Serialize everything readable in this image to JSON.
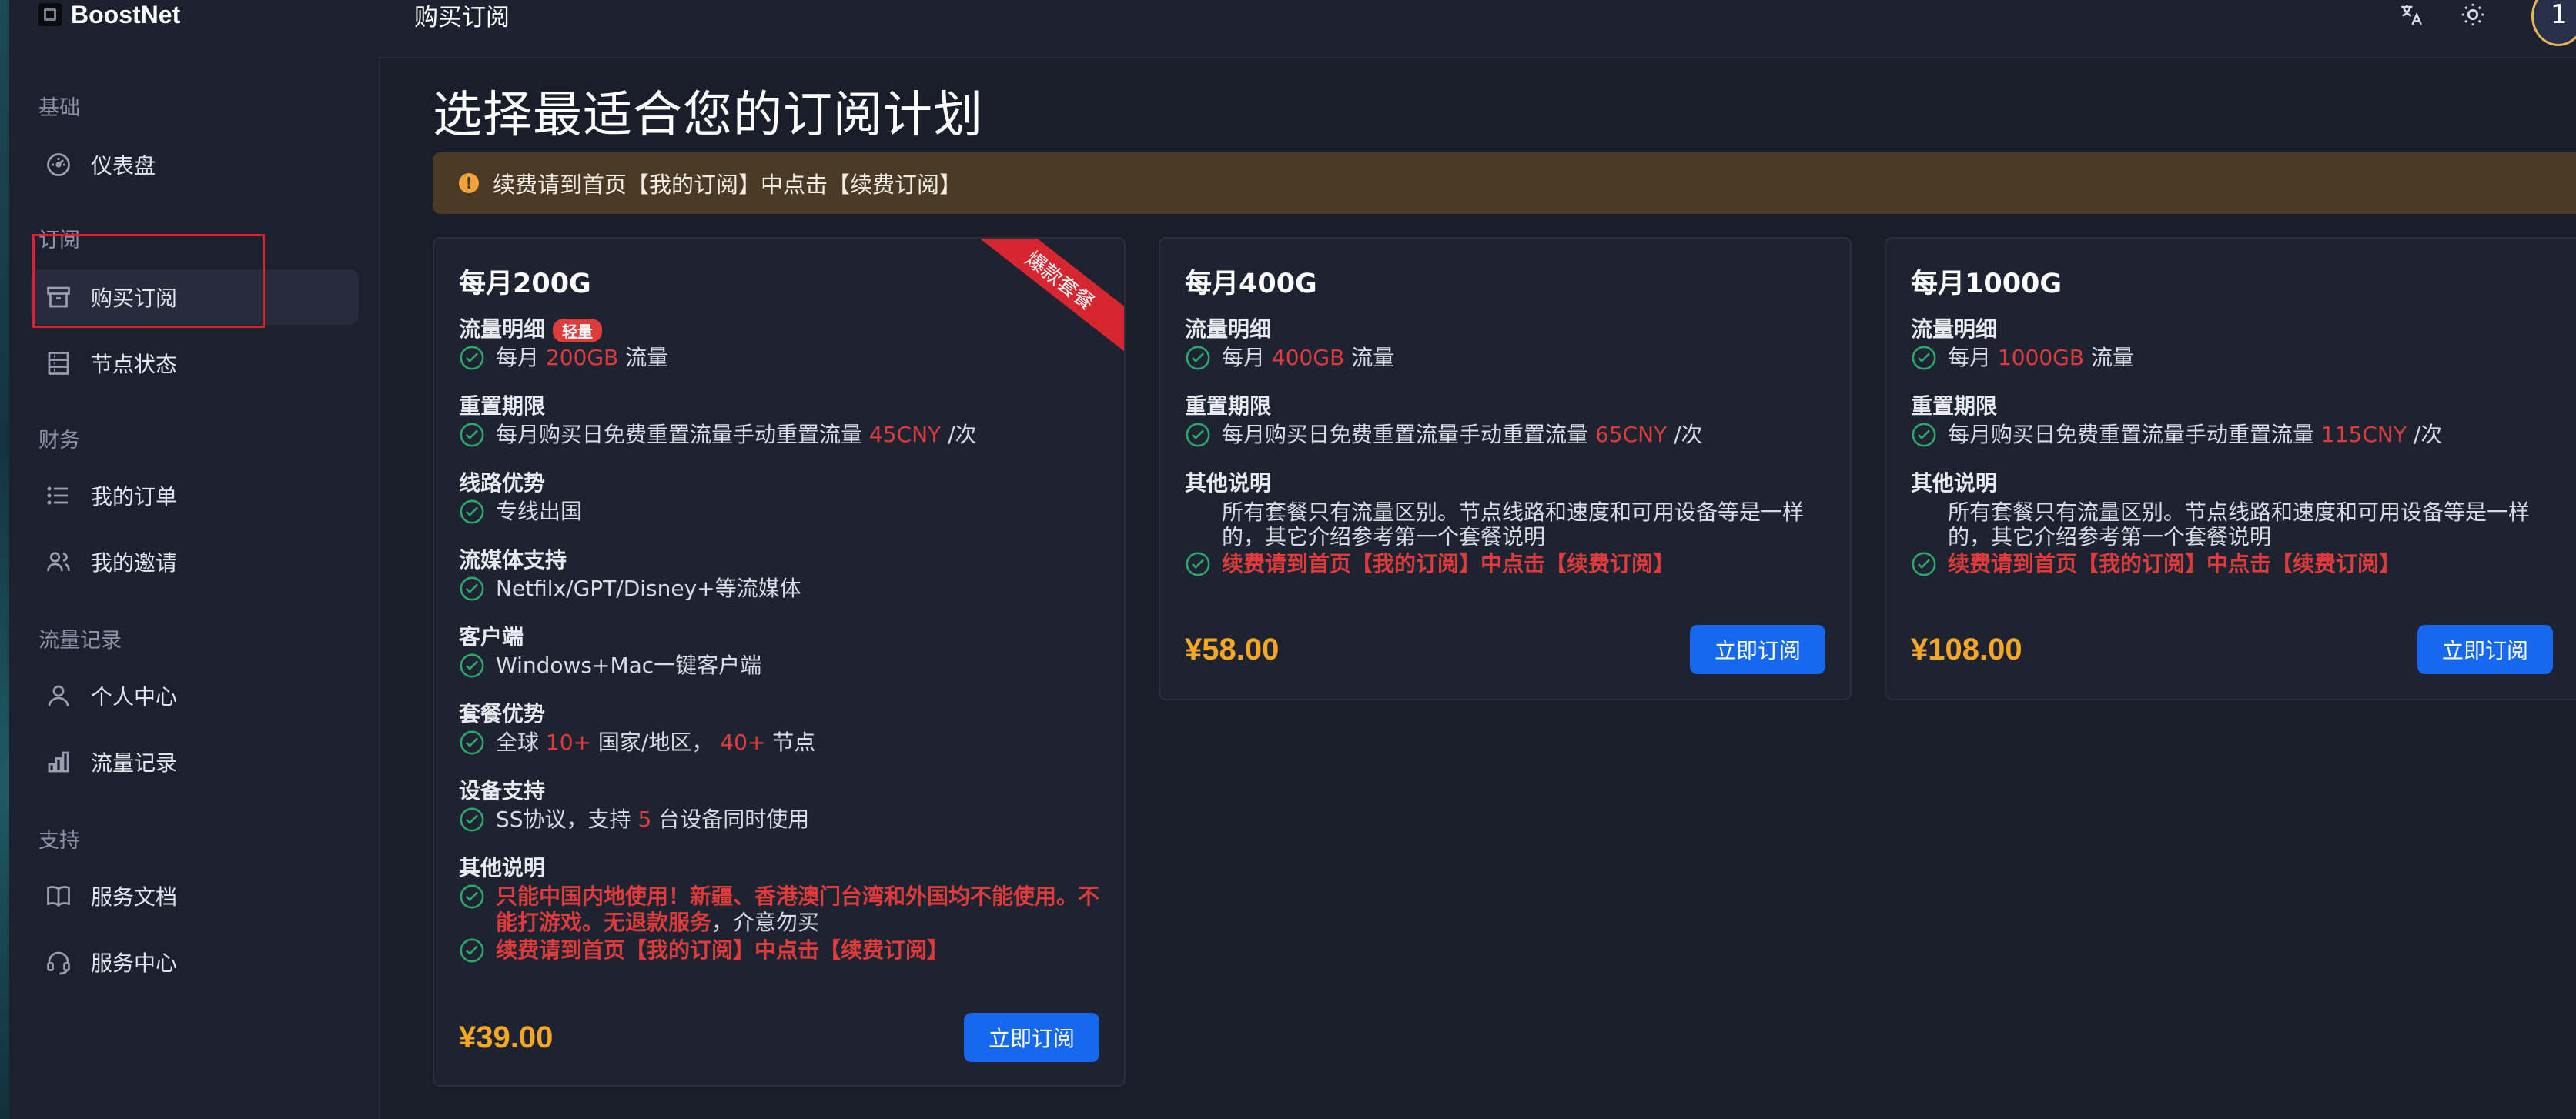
{
  "app": {
    "name": "BoostNet",
    "page_heading": "购买订阅",
    "avatar_text": "1"
  },
  "sidebar": {
    "groups": [
      {
        "label": "基础",
        "items": [
          {
            "label": "仪表盘",
            "icon": "dashboard-icon"
          }
        ]
      },
      {
        "label": "订阅",
        "items": [
          {
            "label": "购买订阅",
            "icon": "box-icon",
            "active": true
          },
          {
            "label": "节点状态",
            "icon": "server-icon"
          }
        ]
      },
      {
        "label": "财务",
        "items": [
          {
            "label": "我的订单",
            "icon": "list-icon"
          },
          {
            "label": "我的邀请",
            "icon": "users-icon"
          }
        ]
      },
      {
        "label": "流量记录",
        "items": [
          {
            "label": "个人中心",
            "icon": "user-icon"
          },
          {
            "label": "流量记录",
            "icon": "bar-chart-icon"
          }
        ]
      },
      {
        "label": "支持",
        "items": [
          {
            "label": "服务文档",
            "icon": "book-icon"
          },
          {
            "label": "服务中心",
            "icon": "headset-icon"
          }
        ]
      }
    ]
  },
  "main": {
    "title": "选择最适合您的订阅计划",
    "alert": "续费请到首页【我的订阅】中点击【续费订阅】"
  },
  "plans": [
    {
      "name": "每月200G",
      "ribbon": "爆款套餐",
      "sections": {
        "traffic_label": "流量明细",
        "traffic_badge": "轻量",
        "traffic_pre": "每月",
        "traffic_val": "200GB",
        "traffic_post": "流量",
        "reset_label": "重置期限",
        "reset_pre": "每月购买日免费重置流量手动重置流量",
        "reset_val": "45CNY",
        "reset_post": "/次",
        "route_label": "线路优势",
        "route_text": "专线出国",
        "media_label": "流媒体支持",
        "media_text": "Netfilx/GPT/Disney+等流媒体",
        "client_label": "客户端",
        "client_text": "Windows+Mac一键客户端",
        "adv_label": "套餐优势",
        "adv_pre": "全球",
        "adv_val1": "10+",
        "adv_mid": "国家/地区，",
        "adv_val2": "40+",
        "adv_post": "节点",
        "device_label": "设备支持",
        "device_pre": "SS协议，支持",
        "device_val": "5",
        "device_post": "台设备同时使用",
        "other_label": "其他说明",
        "other_warn_1": "只能中国内地使用！新疆、香港澳门台湾和外国均不能使用。不",
        "other_warn_2": "能打游戏。无退款服务",
        "other_tail": "，介意勿买",
        "renew": "续费请到首页【我的订阅】中点击【续费订阅】"
      },
      "price": "¥39.00",
      "button": "立即订阅"
    },
    {
      "name": "每月400G",
      "sections": {
        "traffic_label": "流量明细",
        "traffic_pre": "每月",
        "traffic_val": "400GB",
        "traffic_post": "流量",
        "reset_label": "重置期限",
        "reset_pre": "每月购买日免费重置流量手动重置流量",
        "reset_val": "65CNY",
        "reset_post": "/次",
        "other_label": "其他说明",
        "other_1": "所有套餐只有流量区别。节点线路和速度和可用设备等是一样",
        "other_2": "的，其它介绍参考第一个套餐说明",
        "renew": "续费请到首页【我的订阅】中点击【续费订阅】"
      },
      "price": "¥58.00",
      "button": "立即订阅"
    },
    {
      "name": "每月1000G",
      "sections": {
        "traffic_label": "流量明细",
        "traffic_pre": "每月",
        "traffic_val": "1000GB",
        "traffic_post": "流量",
        "reset_label": "重置期限",
        "reset_pre": "每月购买日免费重置流量手动重置流量",
        "reset_val": "115CNY",
        "reset_post": "/次",
        "other_label": "其他说明",
        "other_1": "所有套餐只有流量区别。节点线路和速度和可用设备等是一样",
        "other_2": "的，其它介绍参考第一个套餐说明",
        "renew": "续费请到首页【我的订阅】中点击【续费订阅】"
      },
      "price": "¥108.00",
      "button": "立即订阅"
    }
  ],
  "colors": {
    "accent": "#1668f0",
    "price": "#f5a623",
    "highlight": "#e03b3b",
    "alert_bg": "#4a3a26"
  }
}
